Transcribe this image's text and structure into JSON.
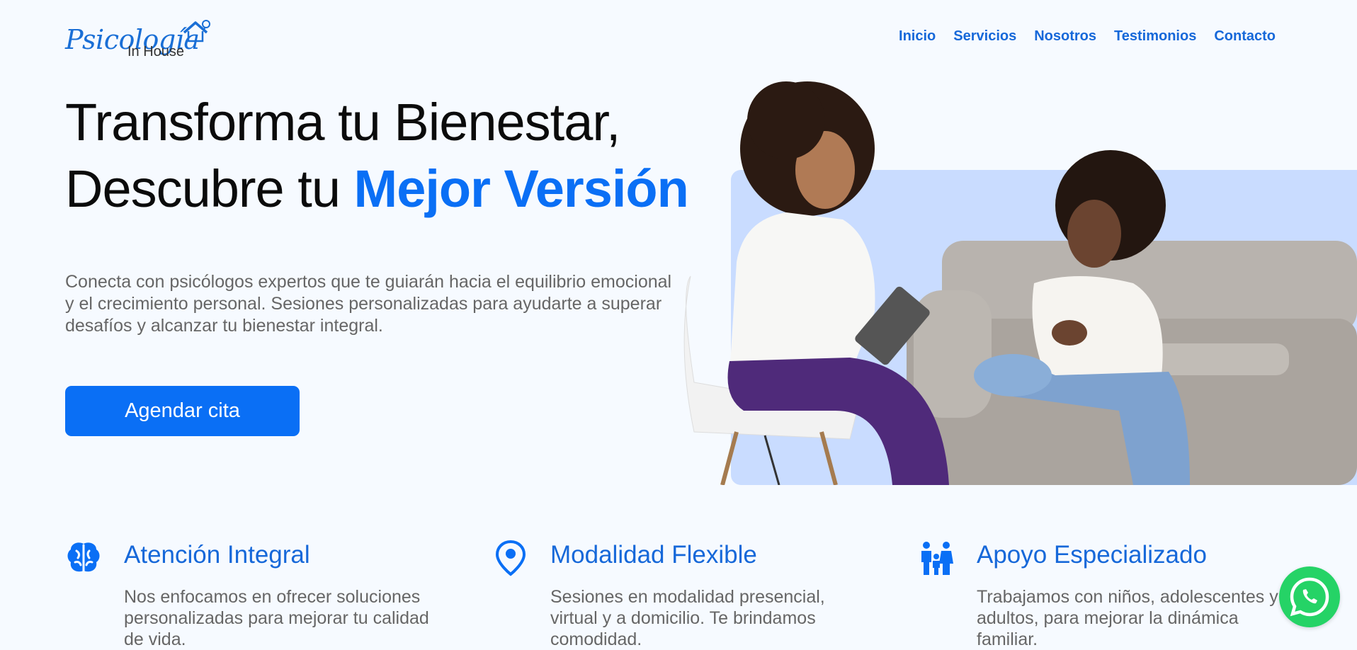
{
  "header": {
    "logo_script": "Psicología",
    "logo_sub": "In House",
    "nav": [
      "Inicio",
      "Servicios",
      "Nosotros",
      "Testimonios",
      "Contacto"
    ]
  },
  "hero": {
    "title_line1": "Transforma tu Bienestar,",
    "title_line2_plain": "Descubre tu ",
    "title_line2_accent": "Mejor Versión",
    "description": "Conecta con psicólogos expertos que te guiarán hacia el equilibrio emocional y el crecimiento personal. Sesiones personalizadas para ayudarte a superar desafíos y alcanzar tu bienestar integral.",
    "cta_label": "Agendar cita"
  },
  "features": [
    {
      "icon": "brain-icon",
      "title": "Atención Integral",
      "text": "Nos enfocamos en ofrecer soluciones personalizadas para mejorar tu calidad de vida."
    },
    {
      "icon": "location-pin-icon",
      "title": "Modalidad Flexible",
      "text": "Sesiones en modalidad presencial, virtual y a domicilio. Te brindamos comodidad."
    },
    {
      "icon": "family-icon",
      "title": "Apoyo Especializado",
      "text": "Trabajamos con niños, adolescentes y adultos, para mejorar la dinámica familiar."
    }
  ],
  "colors": {
    "accent": "#0a6ff5",
    "nav": "#1668d9",
    "background": "#f6faff",
    "photo_backdrop": "#c9dcff",
    "whatsapp": "#25d366"
  }
}
